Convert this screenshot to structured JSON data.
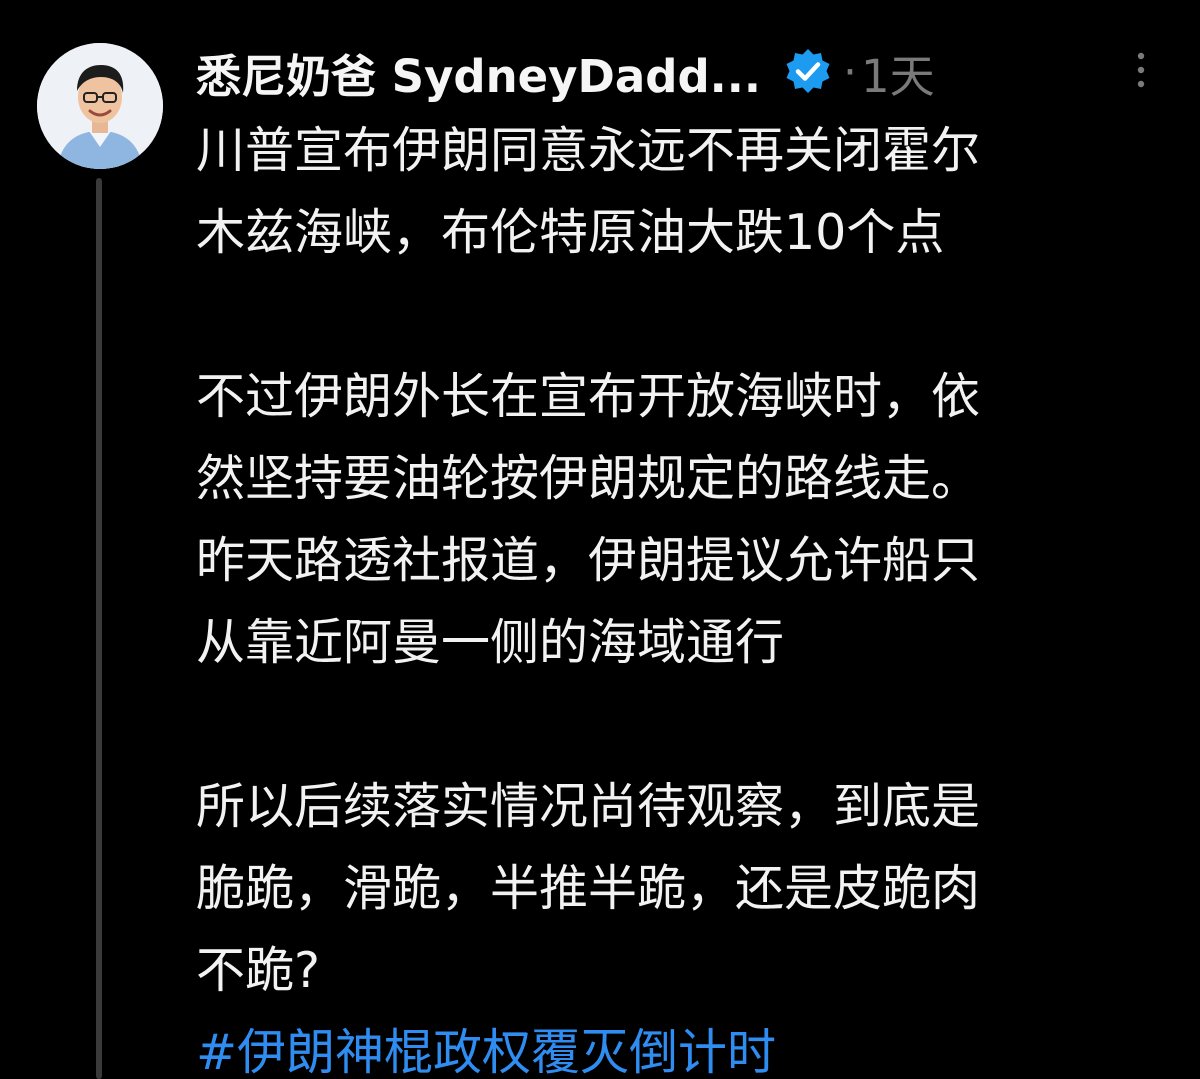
{
  "post": {
    "author": {
      "display_name": "悉尼奶爸 SydneyDadd...",
      "verified_icon": "verified-badge-icon",
      "avatar": "avatar-photo"
    },
    "separator": "·",
    "timestamp": "1天",
    "more_icon": "more-vertical-icon",
    "paragraphs": [
      [
        "川普宣布伊朗同意永远不再关闭霍尔",
        "木兹海峡，布伦特原油大跌10个点"
      ],
      [
        "不过伊朗外长在宣布开放海峡时，依",
        "然坚持要油轮按伊朗规定的路线走。",
        "昨天路透社报道，伊朗提议允许船只",
        "从靠近阿曼一侧的海域通行"
      ],
      [
        "所以后续落实情况尚待观察，到底是",
        "脆跪，滑跪，半推半跪，还是皮跪肉",
        "不跪?"
      ]
    ],
    "hashtag": "#伊朗神棍政权覆灭倒计时"
  },
  "colors": {
    "background": "#000000",
    "text": "#f2f2f2",
    "muted": "#7a7a7a",
    "link": "#2f8cf0",
    "verified": "#1d9bf0",
    "thread_line": "#3a3a3a"
  }
}
